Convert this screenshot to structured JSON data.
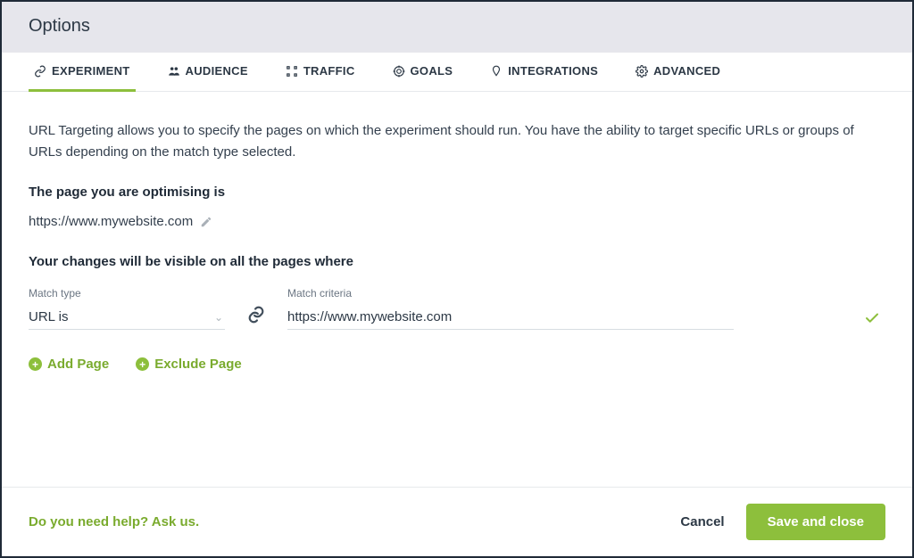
{
  "title": "Options",
  "tabs": {
    "experiment": "EXPERIMENT",
    "audience": "AUDIENCE",
    "traffic": "TRAFFIC",
    "goals": "GOALS",
    "integrations": "INTEGRATIONS",
    "advanced": "ADVANCED"
  },
  "main": {
    "description": "URL Targeting allows you to specify the pages on which the experiment should run. You have the ability to target specific URLs or groups of URLs depending on the match type selected.",
    "page_heading": "The page you are optimising is",
    "page_url": "https://www.mywebsite.com",
    "changes_heading": "Your changes will be visible on all the pages where",
    "match_type_label": "Match type",
    "match_type_value": "URL is",
    "match_criteria_label": "Match criteria",
    "match_criteria_value": "https://www.mywebsite.com",
    "add_page": "Add Page",
    "exclude_page": "Exclude Page"
  },
  "footer": {
    "help": "Do you need help? Ask us.",
    "cancel": "Cancel",
    "save": "Save and close"
  }
}
